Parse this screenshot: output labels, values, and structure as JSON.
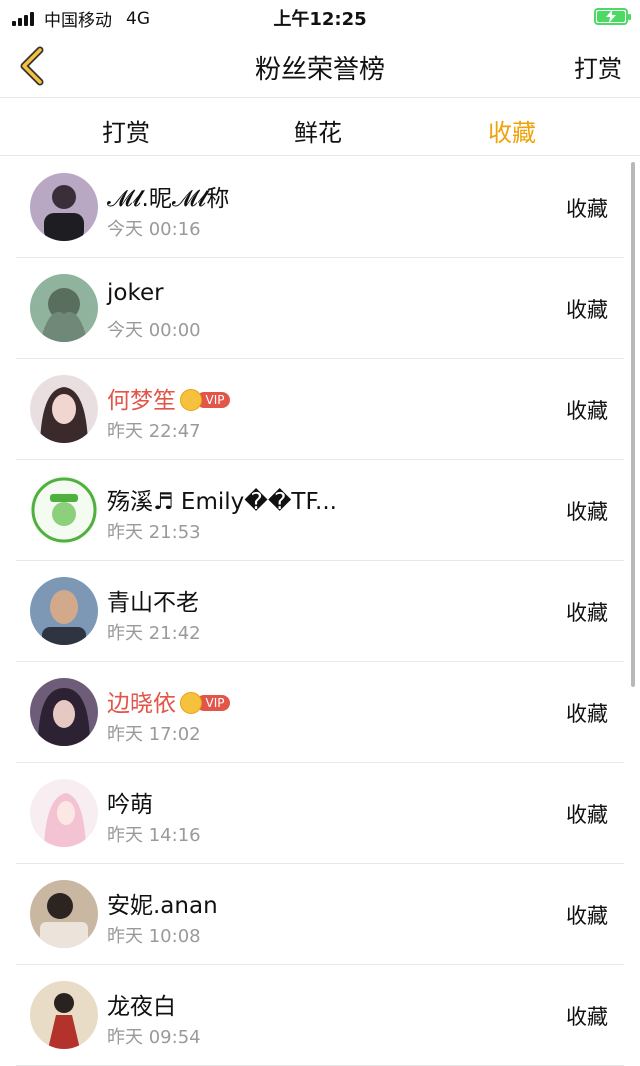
{
  "status": {
    "carrier": "中国移动",
    "network": "4G",
    "time": "上午12:25"
  },
  "nav": {
    "title": "粉丝荣誉榜",
    "right_label": "打赏"
  },
  "tabs": [
    {
      "label": "打赏",
      "active": false
    },
    {
      "label": "鲜花",
      "active": false
    },
    {
      "label": "收藏",
      "active": true
    }
  ],
  "colors": {
    "accent": "#f0a20a",
    "vip_name": "#e2564a",
    "time_text": "#9a9a9a"
  },
  "vip_label": "VIP",
  "rows": [
    {
      "name": "𝓜𝓵.昵𝓜𝓵称",
      "time": "今天 00:16",
      "action": "收藏",
      "vip": false
    },
    {
      "name": "joker",
      "time": "今天 00:00",
      "action": "收藏",
      "vip": false
    },
    {
      "name": "何梦笙",
      "time": "昨天 22:47",
      "action": "收藏",
      "vip": true
    },
    {
      "name": "殇溪♬ Emily��TF...",
      "time": "昨天 21:53",
      "action": "收藏",
      "vip": false
    },
    {
      "name": "青山不老",
      "time": "昨天 21:42",
      "action": "收藏",
      "vip": false
    },
    {
      "name": "边晓依",
      "time": "昨天 17:02",
      "action": "收藏",
      "vip": true
    },
    {
      "name": "吟萌",
      "time": "昨天 14:16",
      "action": "收藏",
      "vip": false
    },
    {
      "name": "安妮.anan",
      "time": "昨天 10:08",
      "action": "收藏",
      "vip": false
    },
    {
      "name": "龙夜白",
      "time": "昨天 09:54",
      "action": "收藏",
      "vip": false
    }
  ]
}
